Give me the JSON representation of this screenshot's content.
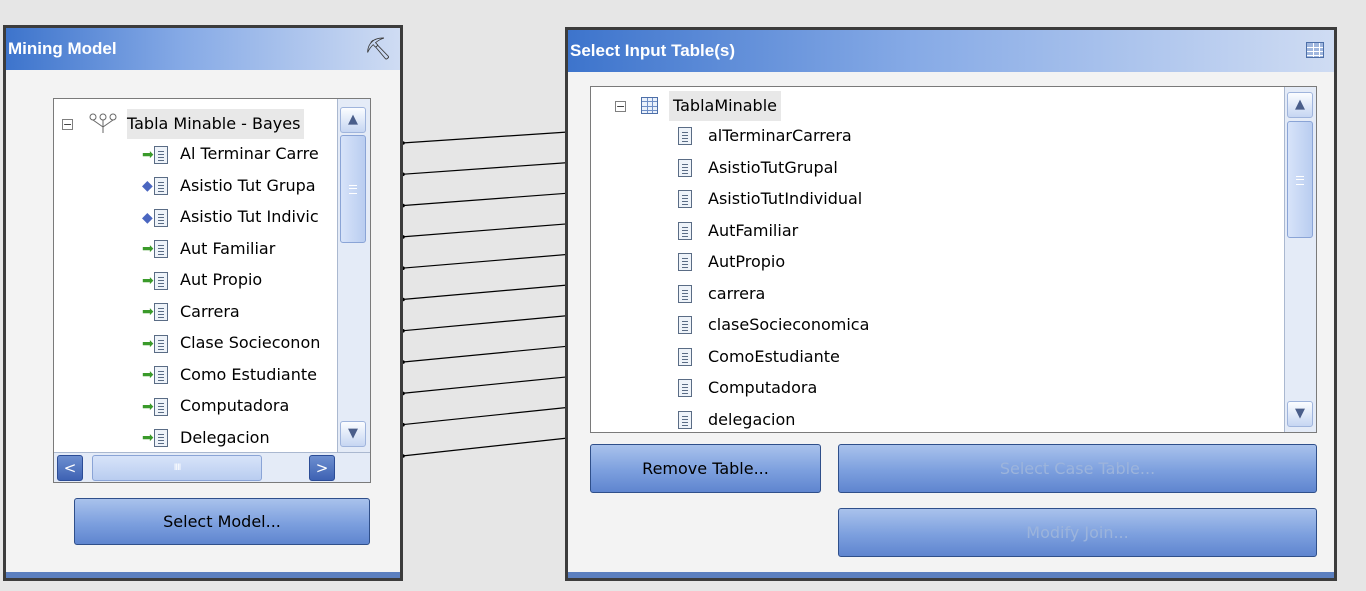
{
  "mining_model": {
    "title": "Mining Model",
    "tree_root": "Tabla Minable - Bayes",
    "columns": [
      {
        "label": "Al Terminar Carre",
        "kind": "input"
      },
      {
        "label": "Asistio Tut Grupa",
        "kind": "predict"
      },
      {
        "label": "Asistio Tut Indivic",
        "kind": "predict"
      },
      {
        "label": "Aut Familiar",
        "kind": "input"
      },
      {
        "label": "Aut Propio",
        "kind": "input"
      },
      {
        "label": "Carrera",
        "kind": "input"
      },
      {
        "label": "Clase Socieconon",
        "kind": "input"
      },
      {
        "label": "Como Estudiante",
        "kind": "input"
      },
      {
        "label": "Computadora",
        "kind": "input"
      },
      {
        "label": "Delegacion",
        "kind": "input"
      }
    ],
    "hscroll_grip": "IIII",
    "select_model_label": "Select Model..."
  },
  "input_tables": {
    "title": "Select Input Table(s)",
    "table_name": "TablaMinable",
    "columns": [
      "alTerminarCarrera",
      "AsistioTutGrupal",
      "AsistioTutIndividual",
      "AutFamiliar",
      "AutPropio",
      "carrera",
      "claseSocieconomica",
      "ComoEstudiante",
      "Computadora",
      "delegacion"
    ],
    "remove_table_label": "Remove Table...",
    "select_case_table_label": "Select Case Table...",
    "modify_join_label": "Modify Join..."
  },
  "colors": {
    "title_gradient_start": "#3d74cc",
    "button_blue": "#7c9fde",
    "disabled_text": "#9cb4dc"
  }
}
